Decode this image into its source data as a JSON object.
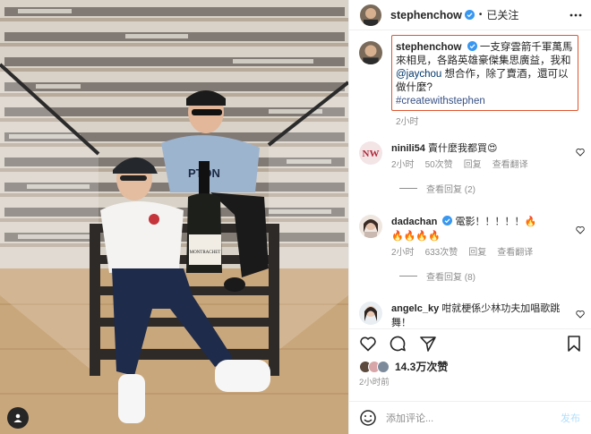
{
  "post": {
    "author": "stephenchow",
    "follow_status": "已关注",
    "dot": "•",
    "caption_line1": "一支穿雲箭千軍萬馬來相見，各路英雄豪傑集思廣益，我和",
    "caption_mention": "@jaychou",
    "caption_line2": "想合作，除了賣酒，還可以做什麼?",
    "caption_tag": "#createwithstephen",
    "caption_time": "2小时",
    "likes": "14.3万次赞",
    "post_time": "2小时前",
    "bottle_label": "MONTRACHET"
  },
  "comments": [
    {
      "user": "ninili54",
      "text": "賣什麼我都買😍",
      "time": "2小时",
      "likes": "50次赞",
      "reply": "回复",
      "translate": "查看翻译",
      "view_replies": "查看回复 (2)"
    },
    {
      "user": "dadachan",
      "text": "電影！！！！！🔥",
      "text2": "🔥🔥🔥🔥",
      "time": "2小时",
      "likes": "633次赞",
      "reply": "回复",
      "translate": "查看翻译",
      "view_replies": "查看回复 (8)"
    },
    {
      "user": "angelc_ky",
      "text": "咁就梗係少林功夫加唱歌跳舞！"
    }
  ],
  "add_comment": {
    "placeholder": "添加评论...",
    "post_label": "发布"
  },
  "icons": {
    "more": "more-horizontal-icon",
    "heart": "heart-icon",
    "comment": "comment-icon",
    "share": "share-icon",
    "save": "bookmark-icon",
    "emoji": "emoji-icon",
    "verified": "verified-badge-icon",
    "user": "user-tag-icon"
  },
  "colors": {
    "highlight_border": "#e0542e",
    "verified": "#3897f0",
    "link": "#00376b",
    "muted": "#8e8e8e",
    "post_button": "#b2dffc"
  }
}
